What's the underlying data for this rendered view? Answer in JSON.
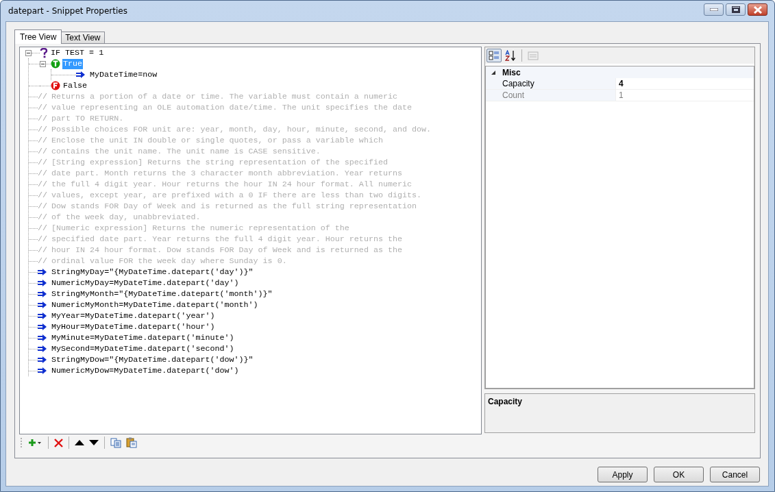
{
  "window": {
    "title": "datepart - Snippet Properties"
  },
  "tabs": [
    {
      "label": "Tree View",
      "selected": true
    },
    {
      "label": "Text View",
      "selected": false
    }
  ],
  "tree": [
    {
      "kind": "condition",
      "text": "IF TEST = 1",
      "expanded": true,
      "selected": false,
      "children": [
        {
          "kind": "true",
          "text": "True",
          "expanded": true,
          "selected": true,
          "children": [
            {
              "kind": "statement",
              "text": "MyDateTime=now",
              "selected": false
            }
          ]
        },
        {
          "kind": "false",
          "text": "False",
          "selected": false
        },
        {
          "kind": "comment",
          "marker": "//",
          "text": "Returns a portion of a date or time. The variable must contain a numeric",
          "selected": false
        },
        {
          "kind": "comment",
          "marker": "//",
          "text": "value representing an OLE automation date/time. The unit specifies the date",
          "selected": false
        },
        {
          "kind": "comment",
          "marker": "//",
          "text": "part TO RETURN.",
          "selected": false
        },
        {
          "kind": "comment",
          "marker": "//",
          "text": "Possible choices FOR unit are: year, month, day, hour, minute, second, and dow.",
          "selected": false
        },
        {
          "kind": "comment",
          "marker": "//",
          "text": "Enclose the unit IN double or single quotes, or pass a variable which",
          "selected": false
        },
        {
          "kind": "comment",
          "marker": "//",
          "text": "contains the unit name. The unit name is CASE sensitive.",
          "selected": false
        },
        {
          "kind": "comment",
          "marker": "//",
          "text": "[String expression] Returns the string representation of the specified",
          "selected": false
        },
        {
          "kind": "comment",
          "marker": "//",
          "text": "date part. Month returns the 3 character month abbreviation. Year returns",
          "selected": false
        },
        {
          "kind": "comment",
          "marker": "//",
          "text": "the full 4 digit year. Hour returns the hour IN 24 hour format. All numeric",
          "selected": false
        },
        {
          "kind": "comment",
          "marker": "//",
          "text": "values, except year, are prefixed with a 0 IF there are less than two digits.",
          "selected": false
        },
        {
          "kind": "comment",
          "marker": "//",
          "text": "Dow stands FOR Day of Week and is returned as the full string representation",
          "selected": false
        },
        {
          "kind": "comment",
          "marker": "//",
          "text": "of the week day, unabbreviated.",
          "selected": false
        },
        {
          "kind": "comment",
          "marker": "//",
          "text": "[Numeric expression] Returns the numeric representation of the",
          "selected": false
        },
        {
          "kind": "comment",
          "marker": "//",
          "text": "specified date part. Year returns the full 4 digit year. Hour returns the",
          "selected": false
        },
        {
          "kind": "comment",
          "marker": "//",
          "text": "hour IN 24 hour format. Dow stands FOR Day of Week and is returned as the",
          "selected": false
        },
        {
          "kind": "comment",
          "marker": "//",
          "text": "ordinal value FOR the week day where Sunday is 0.",
          "selected": false
        },
        {
          "kind": "statement",
          "text": "StringMyDay=\"{MyDateTime.datepart('day')}\"",
          "selected": false
        },
        {
          "kind": "statement",
          "text": "NumericMyDay=MyDateTime.datepart('day')",
          "selected": false
        },
        {
          "kind": "statement",
          "text": "StringMyMonth=\"{MyDateTime.datepart('month')}\"",
          "selected": false
        },
        {
          "kind": "statement",
          "text": "NumericMyMonth=MyDateTime.datepart('month')",
          "selected": false
        },
        {
          "kind": "statement",
          "text": "MyYear=MyDateTime.datepart('year')",
          "selected": false
        },
        {
          "kind": "statement",
          "text": "MyHour=MyDateTime.datepart('hour')",
          "selected": false
        },
        {
          "kind": "statement",
          "text": "MyMinute=MyDateTime.datepart('minute')",
          "selected": false
        },
        {
          "kind": "statement",
          "text": "MySecond=MyDateTime.datepart('second')",
          "selected": false
        },
        {
          "kind": "statement",
          "text": "StringMyDow=\"{MyDateTime.datepart('dow')}\"",
          "selected": false
        },
        {
          "kind": "statement",
          "text": "NumericMyDow=MyDateTime.datepart('dow')",
          "selected": false
        }
      ]
    }
  ],
  "tree_toolbar": [
    {
      "kind": "add"
    },
    {
      "kind": "delete"
    },
    {
      "kind": "move-up"
    },
    {
      "kind": "move-down"
    },
    {
      "kind": "copy"
    },
    {
      "kind": "paste"
    }
  ],
  "property_grid": {
    "toolbar": [
      {
        "kind": "categorized",
        "selected": true,
        "disabled": false
      },
      {
        "kind": "alphabetical",
        "selected": false,
        "disabled": false
      },
      {
        "kind": "pages",
        "selected": false,
        "disabled": true
      }
    ],
    "category": {
      "name": "Misc",
      "expanded": true
    },
    "properties": [
      {
        "name": "Capacity",
        "value": "4",
        "modified": true,
        "readonly": false
      },
      {
        "name": "Count",
        "value": "1",
        "modified": false,
        "readonly": true
      }
    ],
    "description": {
      "title": "Capacity"
    }
  },
  "buttons": [
    {
      "label": "Apply"
    },
    {
      "label": "OK"
    },
    {
      "label": "Cancel"
    }
  ]
}
